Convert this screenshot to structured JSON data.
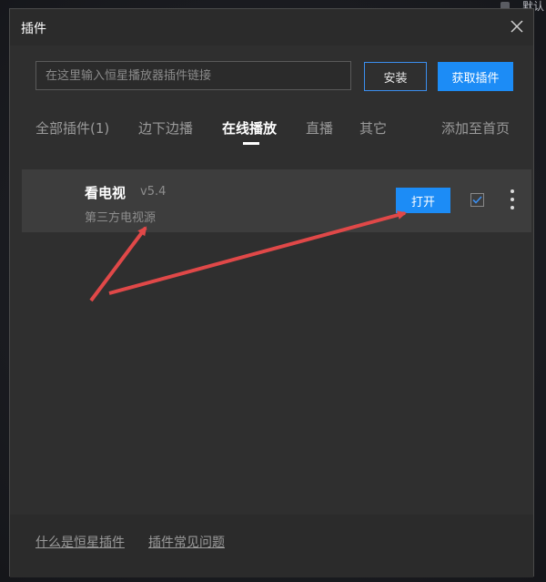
{
  "background": {
    "corner_text": "默认"
  },
  "dialog": {
    "title": "插件"
  },
  "search": {
    "placeholder": "在这里输入恒星播放器插件链接",
    "value": ""
  },
  "buttons": {
    "install": "安装",
    "get_plugins": "获取插件"
  },
  "tabs": [
    {
      "label": "全部插件(1)",
      "active": false
    },
    {
      "label": "边下边播",
      "active": false
    },
    {
      "label": "在线播放",
      "active": true
    },
    {
      "label": "直播",
      "active": false
    },
    {
      "label": "其它",
      "active": false
    }
  ],
  "add_to_home": "添加至首页",
  "plugin": {
    "name": "看电视",
    "version": "v5.4",
    "description": "第三方电视源",
    "open_label": "打开",
    "checked": true
  },
  "footer": {
    "link1": "什么是恒星插件",
    "link2": "插件常见问题"
  },
  "colors": {
    "accent": "#1c8cf6",
    "annotation": "#e04848"
  }
}
